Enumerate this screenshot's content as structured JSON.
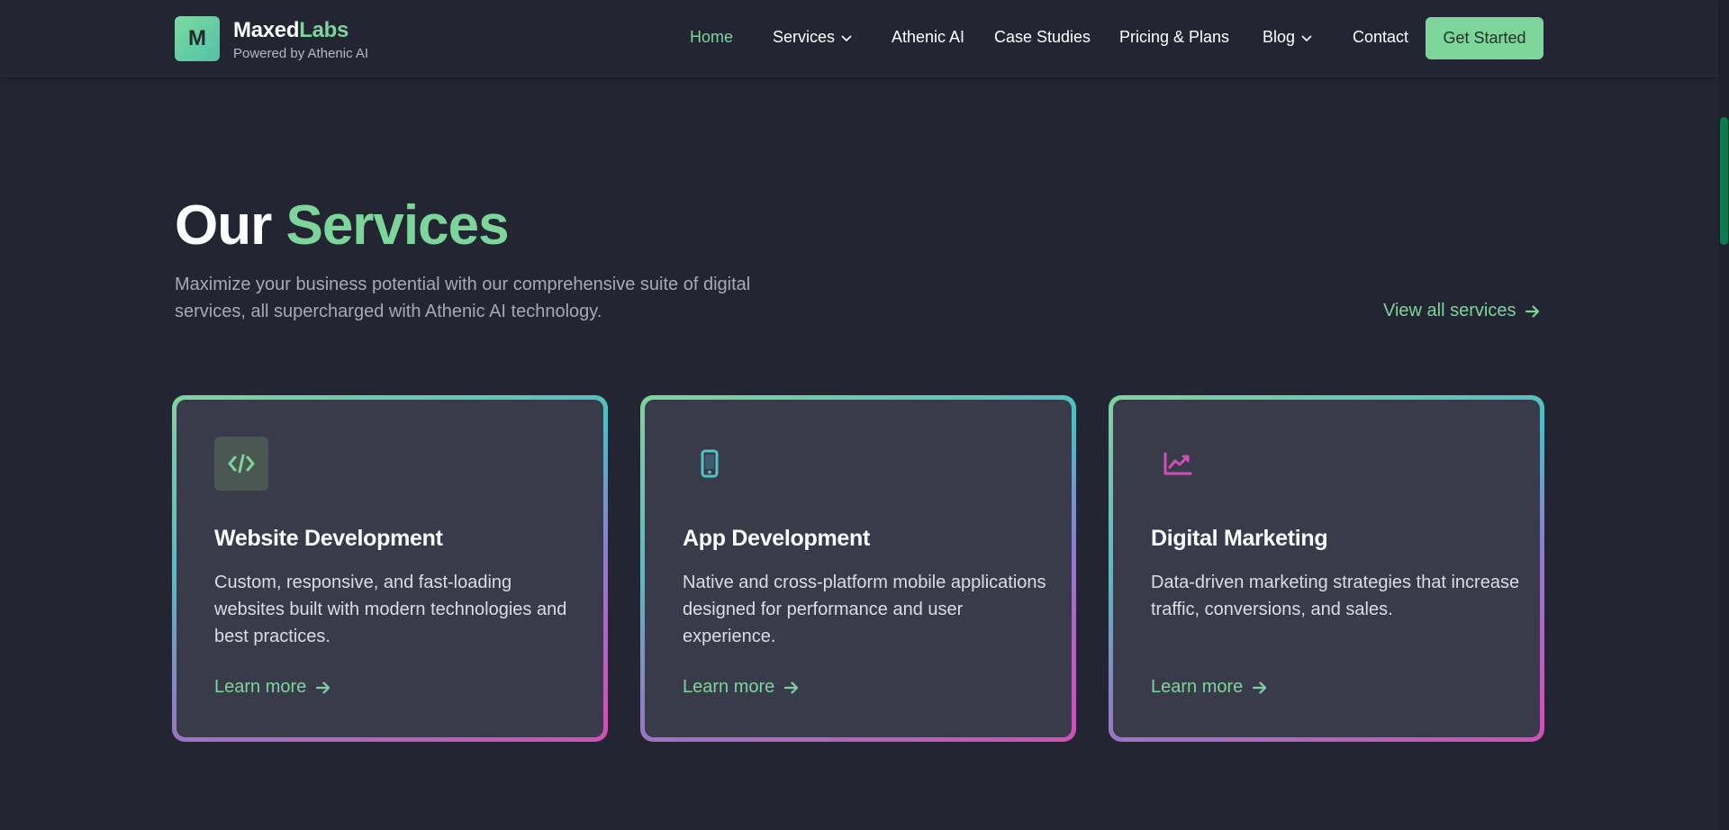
{
  "header": {
    "logo_letter": "M",
    "brand_main": "Maxed",
    "brand_accent": "Labs",
    "tagline": "Powered by Athenic AI",
    "nav": [
      {
        "label": "Home",
        "active": true
      },
      {
        "label": "Services",
        "dropdown": true
      },
      {
        "label": "Athenic AI"
      },
      {
        "label": "Case Studies"
      },
      {
        "label": "Pricing & Plans"
      },
      {
        "label": "Blog",
        "dropdown": true
      },
      {
        "label": "Contact"
      }
    ],
    "cta_label": "Get Started"
  },
  "section": {
    "title_plain": "Our",
    "title_accent": "Services",
    "description": "Maximize your business potential with our comprehensive suite of digital services, all supercharged with Athenic AI technology.",
    "view_all_label": "View all services"
  },
  "cards": [
    {
      "icon": "code-icon",
      "title": "Website Development",
      "description": "Custom, responsive, and fast-loading websites built with modern technologies and best practices.",
      "link_label": "Learn more"
    },
    {
      "icon": "mobile-phone-icon",
      "title": "App Development",
      "description": "Native and cross-platform mobile applications designed for performance and user experience.",
      "link_label": "Learn more"
    },
    {
      "icon": "chart-line-icon",
      "title": "Digital Marketing",
      "description": "Data-driven marketing strategies that increase traffic, conversions, and sales.",
      "link_label": "Learn more"
    }
  ],
  "colors": {
    "background": "#232532",
    "accent": "#7dd59c",
    "card": "#393b4b",
    "icon_teal": "#4fc3c8",
    "icon_magenta": "#d04fb6",
    "scroll_thumb": "#0e7a4f"
  }
}
